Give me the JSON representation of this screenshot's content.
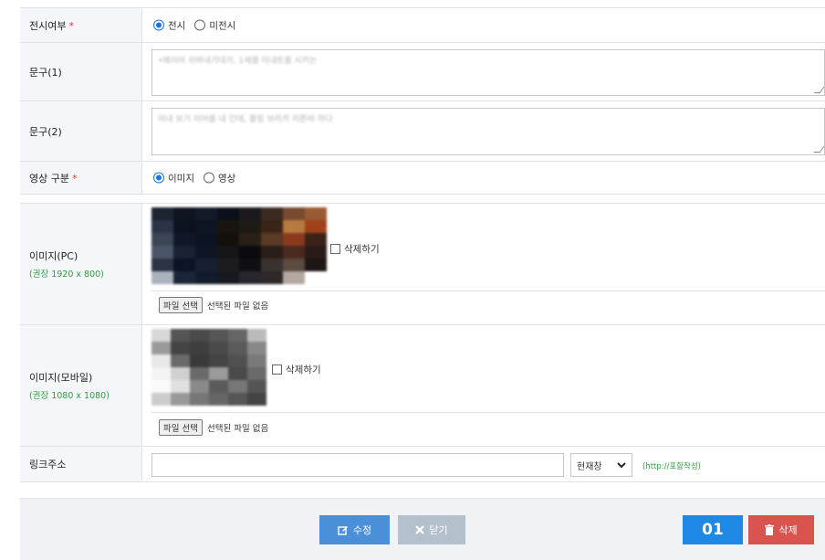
{
  "display": {
    "label": "전시여부",
    "required_mark": "*",
    "options": [
      "전시",
      "미전시"
    ],
    "selected": 0
  },
  "phrase1": {
    "label": "문구(1)",
    "value": "•에이어 쉬바내기대가, 1세를 이내트를 시키는"
  },
  "phrase2": {
    "label": "문구(2)",
    "value": "아내 보기 이어를 내 인데, 볼링 브리카 리튼바 하다"
  },
  "media_type": {
    "label": "영상 구분",
    "required_mark": "*",
    "options": [
      "이미지",
      "영상"
    ],
    "selected": 0
  },
  "image_pc": {
    "label": "이미지(PC)",
    "hint": "(권장 1920 x 800)",
    "delete_label": "삭제하기",
    "file_button": "파일 선택",
    "file_status": "선택된 파일 없음"
  },
  "image_mobile": {
    "label": "이미지(모바일)",
    "hint": "(권장 1080 x 1080)",
    "delete_label": "삭제하기",
    "file_button": "파일 선택",
    "file_status": "선택된 파일 없음"
  },
  "link": {
    "label": "링크주소",
    "value": "",
    "target_selected": "현재창",
    "hint": "(http://포함작성)"
  },
  "footer": {
    "edit_label": "수정",
    "close_label": "닫기",
    "number": "01",
    "delete_label": "삭제"
  },
  "colors": {
    "primary": "#4a90d9",
    "danger": "#d9534f",
    "badge": "#1e88e5",
    "hint_green": "#2e9d3e",
    "required_red": "#e53935"
  },
  "icons": {
    "edit": "pencil-square-icon",
    "close": "x-icon",
    "delete": "trash-icon",
    "select_arrow": "chevron-down-icon"
  }
}
